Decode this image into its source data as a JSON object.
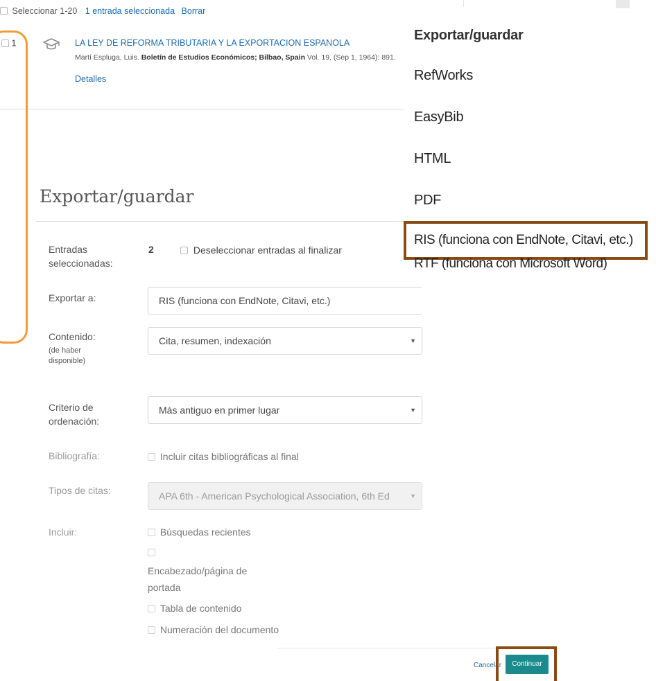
{
  "top_bar": {
    "select_range": "Seleccionar 1-20",
    "selected_count": "1 entrada seleccionada",
    "clear": "Borrar"
  },
  "result": {
    "number": "1",
    "title": "LA LEY DE REFORMA TRIBUTARIA Y LA EXPORTACION ESPANOLA",
    "author": "Martí Espluga, Luis.",
    "journal": "Boletín de Estudios Económicos; Bilbao, Spain",
    "citation": " Vol. 19,  (Sep 1, 1964): 891.",
    "details": "Detalles",
    "icon": "graduation-cap-icon"
  },
  "export_menu": {
    "header": "Exportar/guardar",
    "items": [
      "RefWorks",
      "EasyBib",
      "HTML",
      "PDF",
      "RIS (funciona con EndNote, Citavi, etc.)",
      "RTF (funciona con Microsoft Word)"
    ],
    "highlighted_item": "RIS (funciona con EndNote, Citavi, etc.)"
  },
  "dialog": {
    "title": "Exportar/guardar",
    "entries_label": "Entradas seleccionadas:",
    "entries_count": "2",
    "deselect_label": "Deseleccionar entradas al finalizar",
    "export_to_label": "Exportar a:",
    "export_to_value": "RIS (funciona con EndNote, Citavi, etc.)",
    "content_label": "Contenido:",
    "content_note": "(de haber disponible)",
    "content_value": "Cita, resumen, indexación",
    "sort_label": "Criterio de ordenación:",
    "sort_value": "Más antiguo en primer lugar",
    "bibliography_label": "Bibliografía:",
    "bibliography_option": "Incluir citas bibliográficas al final",
    "citation_types_label": "Tipos de citas:",
    "citation_types_value": "APA 6th - American Psychological Association, 6th Ed",
    "include_label": "Incluir:",
    "include_options": {
      "recent_searches": "Búsquedas recientes",
      "cover_page": "Encabezado/página de portada",
      "toc": "Tabla de contenido",
      "doc_numbering": "Numeración del documento"
    }
  },
  "footer": {
    "cancel": "Cancelar",
    "continue": "Continuar"
  },
  "colors": {
    "link": "#1b6bb0",
    "primary_button": "#1a8a8c",
    "orange_callout": "#f29a3a",
    "brown_callout": "#8a4a14"
  }
}
